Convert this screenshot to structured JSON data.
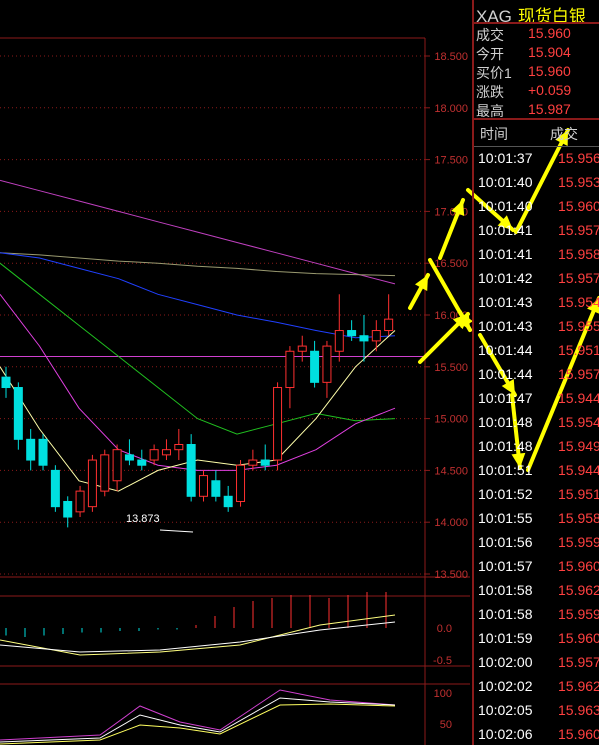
{
  "chart_data": {
    "type": "candlestick",
    "price_axis": {
      "labels": [
        "18.500",
        "18.000",
        "17.500",
        "17.000",
        "16.500",
        "16.000",
        "15.500",
        "15.000",
        "14.500",
        "14.000",
        "13.500"
      ],
      "range": [
        13.5,
        18.5
      ]
    },
    "low_annotation": "13.873",
    "current_price_line": 15.96,
    "candles": [
      {
        "o": 15.4,
        "h": 15.5,
        "l": 15.2,
        "c": 15.3
      },
      {
        "o": 15.3,
        "h": 15.35,
        "l": 14.7,
        "c": 14.8
      },
      {
        "o": 14.8,
        "h": 14.9,
        "l": 14.5,
        "c": 14.6
      },
      {
        "o": 14.8,
        "h": 14.85,
        "l": 14.5,
        "c": 14.55
      },
      {
        "o": 14.5,
        "h": 14.55,
        "l": 14.1,
        "c": 14.15
      },
      {
        "o": 14.2,
        "h": 14.25,
        "l": 13.95,
        "c": 14.05
      },
      {
        "o": 14.1,
        "h": 14.35,
        "l": 14.05,
        "c": 14.3
      },
      {
        "o": 14.15,
        "h": 14.65,
        "l": 14.1,
        "c": 14.6
      },
      {
        "o": 14.3,
        "h": 14.7,
        "l": 14.25,
        "c": 14.65
      },
      {
        "o": 14.4,
        "h": 14.75,
        "l": 14.3,
        "c": 14.7
      },
      {
        "o": 14.65,
        "h": 14.8,
        "l": 14.55,
        "c": 14.6
      },
      {
        "o": 14.6,
        "h": 14.7,
        "l": 14.5,
        "c": 14.55
      },
      {
        "o": 14.6,
        "h": 14.75,
        "l": 14.55,
        "c": 14.7
      },
      {
        "o": 14.65,
        "h": 14.8,
        "l": 14.6,
        "c": 14.7
      },
      {
        "o": 14.7,
        "h": 14.9,
        "l": 14.6,
        "c": 14.75
      },
      {
        "o": 14.75,
        "h": 14.85,
        "l": 14.2,
        "c": 14.25
      },
      {
        "o": 14.25,
        "h": 14.5,
        "l": 14.2,
        "c": 14.45
      },
      {
        "o": 14.4,
        "h": 14.5,
        "l": 14.2,
        "c": 14.25
      },
      {
        "o": 14.25,
        "h": 14.35,
        "l": 14.1,
        "c": 14.15
      },
      {
        "o": 14.2,
        "h": 14.6,
        "l": 14.15,
        "c": 14.55
      },
      {
        "o": 14.55,
        "h": 14.7,
        "l": 14.5,
        "c": 14.6
      },
      {
        "o": 14.6,
        "h": 14.75,
        "l": 14.5,
        "c": 14.55
      },
      {
        "o": 14.6,
        "h": 15.35,
        "l": 14.5,
        "c": 15.3
      },
      {
        "o": 15.3,
        "h": 15.7,
        "l": 15.1,
        "c": 15.65
      },
      {
        "o": 15.65,
        "h": 15.8,
        "l": 15.55,
        "c": 15.7
      },
      {
        "o": 15.65,
        "h": 15.75,
        "l": 15.3,
        "c": 15.35
      },
      {
        "o": 15.35,
        "h": 15.75,
        "l": 15.2,
        "c": 15.7
      },
      {
        "o": 15.65,
        "h": 16.2,
        "l": 15.55,
        "c": 15.85
      },
      {
        "o": 15.85,
        "h": 15.95,
        "l": 15.75,
        "c": 15.8
      },
      {
        "o": 15.8,
        "h": 16.0,
        "l": 15.55,
        "c": 15.75
      },
      {
        "o": 15.75,
        "h": 15.95,
        "l": 15.65,
        "c": 15.85
      },
      {
        "o": 15.85,
        "h": 16.2,
        "l": 15.8,
        "c": 15.96
      }
    ],
    "moving_averages": [
      {
        "color": "#c040c0",
        "values": [
          17.3,
          17.2,
          17.1,
          17.0,
          16.9,
          16.8,
          16.7,
          16.6,
          16.5,
          16.4,
          16.3
        ]
      },
      {
        "color": "#9a9a70",
        "values": [
          16.6,
          16.58,
          16.55,
          16.52,
          16.5,
          16.47,
          16.45,
          16.42,
          16.4,
          16.39,
          16.38
        ]
      },
      {
        "color": "#2040ff",
        "values": [
          16.6,
          16.55,
          16.45,
          16.35,
          16.2,
          16.1,
          16.0,
          15.93,
          15.85,
          15.78,
          15.8
        ]
      },
      {
        "color": "#20c020",
        "values": [
          16.5,
          16.2,
          15.9,
          15.6,
          15.3,
          15.0,
          14.85,
          14.95,
          15.05,
          14.98,
          15.0
        ]
      },
      {
        "color": "#e040e0",
        "values": [
          16.2,
          15.7,
          15.1,
          14.7,
          14.55,
          14.5,
          14.5,
          14.55,
          14.7,
          14.95,
          15.1
        ]
      },
      {
        "color": "#ffffaa",
        "values": [
          15.5,
          14.9,
          14.4,
          14.3,
          14.5,
          14.6,
          14.55,
          14.6,
          15.0,
          15.5,
          15.85
        ]
      }
    ],
    "macd": {
      "axis_labels": [
        "0.0",
        "-0.5"
      ],
      "histogram": [
        -0.05,
        -0.06,
        -0.05,
        -0.04,
        -0.03,
        -0.03,
        -0.02,
        -0.02,
        -0.01,
        -0.01,
        0.02,
        0.08,
        0.14,
        0.18,
        0.2,
        0.22,
        0.22,
        0.2,
        0.22,
        0.24,
        0.24
      ]
    },
    "kdj": {
      "axis_labels": [
        "100",
        "50"
      ]
    }
  },
  "quote": {
    "code": "XAG",
    "name": "现货白银",
    "rows": [
      {
        "k": "成交",
        "v": "15.960"
      },
      {
        "k": "今开",
        "v": "15.904"
      },
      {
        "k": "买价1",
        "v": "15.960"
      },
      {
        "k": "涨跌",
        "v": "+0.059"
      },
      {
        "k": "最高",
        "v": "15.987"
      }
    ],
    "tick_header_time": "时间",
    "tick_header_price": "成交",
    "ticks": [
      {
        "t": "10:01:37",
        "p": "15.956"
      },
      {
        "t": "10:01:40",
        "p": "15.953"
      },
      {
        "t": "10:01:40",
        "p": "15.960"
      },
      {
        "t": "10:01:41",
        "p": "15.957"
      },
      {
        "t": "10:01:41",
        "p": "15.958"
      },
      {
        "t": "10:01:42",
        "p": "15.957"
      },
      {
        "t": "10:01:43",
        "p": "15.954"
      },
      {
        "t": "10:01:43",
        "p": "15.955"
      },
      {
        "t": "10:01:44",
        "p": "15.951"
      },
      {
        "t": "10:01:44",
        "p": "15.957"
      },
      {
        "t": "10:01:47",
        "p": "15.944"
      },
      {
        "t": "10:01:48",
        "p": "15.954"
      },
      {
        "t": "10:01:48",
        "p": "15.949"
      },
      {
        "t": "10:01:51",
        "p": "15.944"
      },
      {
        "t": "10:01:52",
        "p": "15.951"
      },
      {
        "t": "10:01:55",
        "p": "15.958"
      },
      {
        "t": "10:01:56",
        "p": "15.959"
      },
      {
        "t": "10:01:57",
        "p": "15.960"
      },
      {
        "t": "10:01:58",
        "p": "15.962"
      },
      {
        "t": "10:01:58",
        "p": "15.959"
      },
      {
        "t": "10:01:59",
        "p": "15.960"
      },
      {
        "t": "10:02:00",
        "p": "15.957"
      },
      {
        "t": "10:02:02",
        "p": "15.962"
      },
      {
        "t": "10:02:05",
        "p": "15.963"
      },
      {
        "t": "10:02:06",
        "p": "15.960"
      }
    ]
  }
}
